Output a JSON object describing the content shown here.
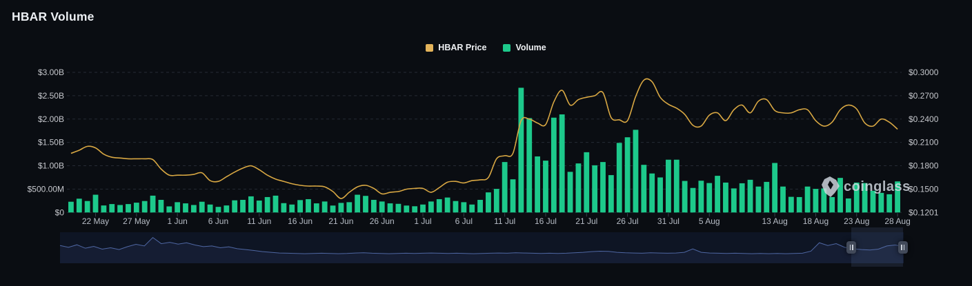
{
  "page": {
    "title": "HBAR Volume"
  },
  "legend": [
    {
      "label": "HBAR Price",
      "color": "#e3b35a"
    },
    {
      "label": "Volume",
      "color": "#1dc98b"
    }
  ],
  "watermark": {
    "label": "coinglass",
    "icon": "coinglass-gem-icon"
  },
  "colors": {
    "background": "#0a0d12",
    "grid": "#262b34",
    "bar_green": "#1dc98b",
    "price_yellow": "#d9a843",
    "axis_label": "#c6c8cd",
    "date_label": "#b7bdc6",
    "tick_mark": "#3b424d",
    "nav_bg": "#0e1524",
    "nav_line": "#4f67a3",
    "nav_fill": "#151d33"
  },
  "chart_data": {
    "type": "bar",
    "title": "HBAR Volume",
    "legend_position": "top-center",
    "grid": "dashed-horizontal",
    "left_axis": {
      "title": "",
      "unit": "USD",
      "max": 3000000000,
      "min": 0,
      "tick_labels": [
        "$3.00B",
        "$2.50B",
        "$2.00B",
        "$1.50B",
        "$1.00B",
        "$500.00M",
        "$0"
      ]
    },
    "right_axis": {
      "title": "",
      "unit": "USD",
      "max": 0.3,
      "min": 0.1201,
      "tick_labels": [
        "$0.3000",
        "$0.2700",
        "$0.2400",
        "$0.2100",
        "$0.1800",
        "$0.1500",
        "$0.1201"
      ]
    },
    "x_tick_labels": [
      "22 May",
      "27 May",
      "1 Jun",
      "6 Jun",
      "11 Jun",
      "16 Jun",
      "21 Jun",
      "26 Jun",
      "1 Jul",
      "6 Jul",
      "11 Jul",
      "16 Jul",
      "21 Jul",
      "26 Jul",
      "31 Jul",
      "5 Aug",
      "13 Aug",
      "18 Aug",
      "23 Aug",
      "28 Aug"
    ],
    "x_tick_indices": [
      3,
      8,
      13,
      18,
      23,
      28,
      33,
      38,
      43,
      48,
      53,
      58,
      63,
      68,
      73,
      78,
      86,
      91,
      96,
      101
    ],
    "x": [
      "19 May",
      "20 May",
      "21 May",
      "22 May",
      "23 May",
      "24 May",
      "25 May",
      "26 May",
      "27 May",
      "28 May",
      "29 May",
      "30 May",
      "31 May",
      "1 Jun",
      "2 Jun",
      "3 Jun",
      "4 Jun",
      "5 Jun",
      "6 Jun",
      "7 Jun",
      "8 Jun",
      "9 Jun",
      "10 Jun",
      "11 Jun",
      "12 Jun",
      "13 Jun",
      "14 Jun",
      "15 Jun",
      "16 Jun",
      "17 Jun",
      "18 Jun",
      "19 Jun",
      "20 Jun",
      "21 Jun",
      "22 Jun",
      "23 Jun",
      "24 Jun",
      "25 Jun",
      "26 Jun",
      "27 Jun",
      "28 Jun",
      "29 Jun",
      "30 Jun",
      "1 Jul",
      "2 Jul",
      "3 Jul",
      "4 Jul",
      "5 Jul",
      "6 Jul",
      "7 Jul",
      "8 Jul",
      "9 Jul",
      "10 Jul",
      "11 Jul",
      "12 Jul",
      "13 Jul",
      "14 Jul",
      "15 Jul",
      "16 Jul",
      "17 Jul",
      "18 Jul",
      "19 Jul",
      "20 Jul",
      "21 Jul",
      "22 Jul",
      "23 Jul",
      "24 Jul",
      "25 Jul",
      "26 Jul",
      "27 Jul",
      "28 Jul",
      "29 Jul",
      "30 Jul",
      "31 Jul",
      "1 Aug",
      "2 Aug",
      "3 Aug",
      "4 Aug",
      "5 Aug",
      "6 Aug",
      "7 Aug",
      "8 Aug",
      "9 Aug",
      "10 Aug",
      "11 Aug",
      "12 Aug",
      "13 Aug",
      "14 Aug",
      "15 Aug",
      "16 Aug",
      "17 Aug",
      "18 Aug",
      "19 Aug",
      "20 Aug",
      "21 Aug",
      "22 Aug",
      "23 Aug",
      "24 Aug",
      "25 Aug",
      "26 Aug",
      "27 Aug",
      "28 Aug"
    ],
    "series": [
      {
        "name": "Volume",
        "type": "bar",
        "axis": "left",
        "unit": "USD millions",
        "values": [
          230,
          295,
          245,
          380,
          150,
          180,
          160,
          180,
          210,
          245,
          360,
          270,
          130,
          220,
          195,
          160,
          230,
          170,
          120,
          150,
          260,
          270,
          345,
          255,
          330,
          360,
          200,
          170,
          265,
          285,
          195,
          235,
          148,
          205,
          220,
          380,
          355,
          270,
          235,
          195,
          185,
          148,
          133,
          170,
          235,
          285,
          320,
          245,
          220,
          170,
          270,
          430,
          505,
          1080,
          710,
          2670,
          2020,
          1200,
          1110,
          2030,
          2100,
          870,
          1050,
          1290,
          1010,
          1080,
          800,
          1490,
          1610,
          1770,
          1020,
          835,
          750,
          1130,
          1130,
          675,
          525,
          680,
          630,
          785,
          640,
          515,
          625,
          700,
          555,
          655,
          1060,
          555,
          335,
          330,
          555,
          505,
          515,
          330,
          740,
          300,
          640,
          630,
          465,
          420,
          390,
          665
        ]
      },
      {
        "name": "HBAR Price",
        "type": "line",
        "axis": "right",
        "unit": "USD",
        "values": [
          0.196,
          0.2,
          0.205,
          0.203,
          0.195,
          0.191,
          0.19,
          0.189,
          0.189,
          0.189,
          0.188,
          0.176,
          0.168,
          0.168,
          0.168,
          0.169,
          0.171,
          0.161,
          0.16,
          0.166,
          0.172,
          0.177,
          0.18,
          0.175,
          0.168,
          0.163,
          0.16,
          0.157,
          0.155,
          0.154,
          0.154,
          0.153,
          0.147,
          0.138,
          0.146,
          0.153,
          0.155,
          0.151,
          0.144,
          0.146,
          0.147,
          0.15,
          0.151,
          0.151,
          0.146,
          0.152,
          0.159,
          0.16,
          0.158,
          0.161,
          0.162,
          0.165,
          0.189,
          0.193,
          0.196,
          0.238,
          0.24,
          0.235,
          0.233,
          0.262,
          0.277,
          0.258,
          0.265,
          0.268,
          0.27,
          0.274,
          0.242,
          0.239,
          0.238,
          0.269,
          0.29,
          0.288,
          0.268,
          0.259,
          0.254,
          0.246,
          0.232,
          0.231,
          0.245,
          0.248,
          0.238,
          0.252,
          0.258,
          0.248,
          0.263,
          0.265,
          0.251,
          0.248,
          0.248,
          0.252,
          0.252,
          0.238,
          0.231,
          0.236,
          0.252,
          0.258,
          0.253,
          0.235,
          0.231,
          0.24,
          0.236,
          0.227
        ]
      }
    ]
  },
  "navigator": {
    "selection_start_frac": 0.938,
    "selection_end_frac": 0.999,
    "values": [
      0.6,
      0.52,
      0.63,
      0.48,
      0.56,
      0.44,
      0.5,
      0.42,
      0.55,
      0.65,
      0.58,
      0.95,
      0.68,
      0.74,
      0.66,
      0.72,
      0.62,
      0.55,
      0.58,
      0.5,
      0.54,
      0.46,
      0.42,
      0.38,
      0.33,
      0.3,
      0.27,
      0.26,
      0.25,
      0.24,
      0.25,
      0.26,
      0.25,
      0.24,
      0.25,
      0.27,
      0.28,
      0.26,
      0.25,
      0.24,
      0.25,
      0.26,
      0.25,
      0.26,
      0.27,
      0.26,
      0.25,
      0.26,
      0.25,
      0.24,
      0.25,
      0.26,
      0.27,
      0.26,
      0.28,
      0.27,
      0.26,
      0.25,
      0.26,
      0.25,
      0.26,
      0.28,
      0.3,
      0.33,
      0.35,
      0.34,
      0.3,
      0.28,
      0.27,
      0.26,
      0.28,
      0.27,
      0.26,
      0.27,
      0.3,
      0.45,
      0.3,
      0.27,
      0.26,
      0.25,
      0.26,
      0.25,
      0.24,
      0.25,
      0.24,
      0.25,
      0.24,
      0.25,
      0.26,
      0.35,
      0.72,
      0.6,
      0.68,
      0.52,
      0.46,
      0.42,
      0.4,
      0.44,
      0.58,
      0.62,
      0.55
    ]
  }
}
